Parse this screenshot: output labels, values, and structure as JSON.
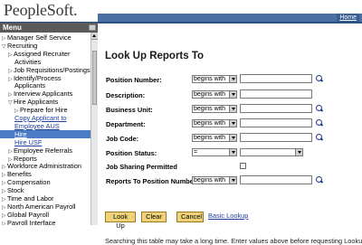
{
  "header": {
    "logo": "PeopleSoft.",
    "home_link": "Home"
  },
  "menu": {
    "title": "Menu",
    "items": [
      {
        "label": "Manager Self Service",
        "style": "collapsed"
      },
      {
        "label": "Recruiting",
        "style": "expanded"
      },
      {
        "label": "Assigned Recruiter",
        "style": "collapsed"
      },
      {
        "label": "Activities",
        "style": "cont"
      },
      {
        "label": "Job Requisitions/Postings",
        "style": "collapsed"
      },
      {
        "label": "Identify/Process",
        "style": "collapsed"
      },
      {
        "label": "Applicants",
        "style": "cont"
      },
      {
        "label": "Interview Applicants",
        "style": "collapsed"
      },
      {
        "label": "Hire Applicants",
        "style": "expanded"
      },
      {
        "label": "Prepare for Hire",
        "style": "collapsed"
      },
      {
        "label": "Copy Applicant to",
        "style": "link"
      },
      {
        "label": "Employee AUS",
        "style": "link"
      },
      {
        "label": "Hire",
        "style": "selected"
      },
      {
        "label": "Hire USF",
        "style": "link"
      },
      {
        "label": "Employee Referrals",
        "style": "collapsed"
      },
      {
        "label": "Reports",
        "style": "collapsed"
      },
      {
        "label": "Workforce Administration",
        "style": "collapsed"
      },
      {
        "label": "Benefits",
        "style": "collapsed"
      },
      {
        "label": "Compensation",
        "style": "collapsed"
      },
      {
        "label": "Stock",
        "style": "collapsed"
      },
      {
        "label": "Time and Labor",
        "style": "collapsed"
      },
      {
        "label": "North American Payroll",
        "style": "collapsed"
      },
      {
        "label": "Global Payroll",
        "style": "collapsed"
      },
      {
        "label": "Payroll Interface",
        "style": "collapsed"
      }
    ]
  },
  "page": {
    "title": "Look Up Reports To",
    "fields": {
      "position_number": {
        "label": "Position Number:",
        "operator": "begins with",
        "value": ""
      },
      "description": {
        "label": "Description:",
        "operator": "begins with",
        "value": ""
      },
      "business_unit": {
        "label": "Business Unit:",
        "operator": "begins with",
        "value": ""
      },
      "department": {
        "label": "Department:",
        "operator": "begins with",
        "value": ""
      },
      "job_code": {
        "label": "Job Code:",
        "operator": "begins with",
        "value": ""
      },
      "position_status": {
        "label": "Position Status:",
        "operator": "=",
        "value": ""
      },
      "job_sharing": {
        "label": "Job Sharing Permitted"
      },
      "reports_to": {
        "label": "Reports To Position Number:",
        "operator": "begins with",
        "value": ""
      }
    },
    "buttons": {
      "lookup": "Look Up",
      "clear": "Clear",
      "cancel": "Cancel",
      "basic_lookup": "Basic Lookup"
    },
    "hint": "Searching this table may take a long time. Enter values above before requesting Lookup."
  }
}
